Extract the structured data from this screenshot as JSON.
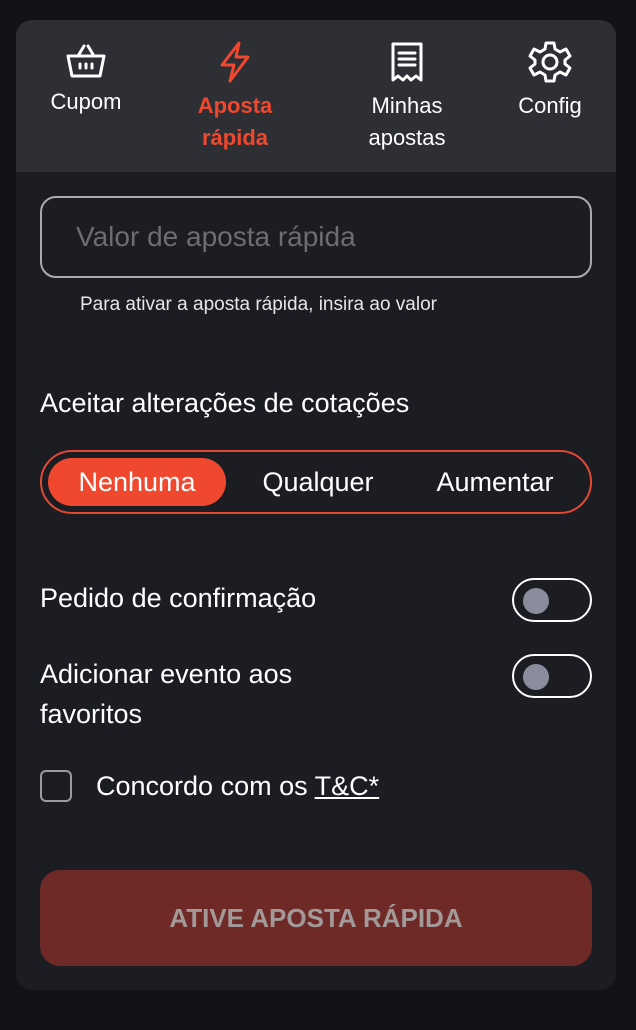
{
  "tabs": {
    "cupom": {
      "label": "Cupom",
      "icon": "basket-icon"
    },
    "rapida": {
      "label_line1": "Aposta",
      "label_line2": "rápida",
      "icon": "lightning-icon",
      "active": true
    },
    "minhas": {
      "label_line1": "Minhas",
      "label_line2": "apostas",
      "icon": "receipt-icon"
    },
    "config": {
      "label": "Config",
      "icon": "gear-icon"
    }
  },
  "quick_bet": {
    "input_placeholder": "Valor de aposta rápida",
    "input_value": "",
    "hint": "Para ativar a aposta rápida, insira ao valor"
  },
  "odds_changes": {
    "label": "Aceitar alterações de cotações",
    "options": [
      "Nenhuma",
      "Qualquer",
      "Aumentar"
    ],
    "selected": "Nenhuma"
  },
  "settings": {
    "confirmation": {
      "label": "Pedido de confirmação",
      "on": false
    },
    "favorites": {
      "label_line1": "Adicionar evento aos",
      "label_line2": "favoritos",
      "on": false
    }
  },
  "terms": {
    "prefix": "Concordo com os ",
    "link": "T&C*",
    "checked": false
  },
  "cta": {
    "label": "ATIVE APOSTA RÁPIDA"
  },
  "colors": {
    "accent": "#f0482f",
    "background": "#111319",
    "panel": "#1c1d22",
    "tabbar": "#2d2f34",
    "cta_disabled": "#6f2a27"
  }
}
